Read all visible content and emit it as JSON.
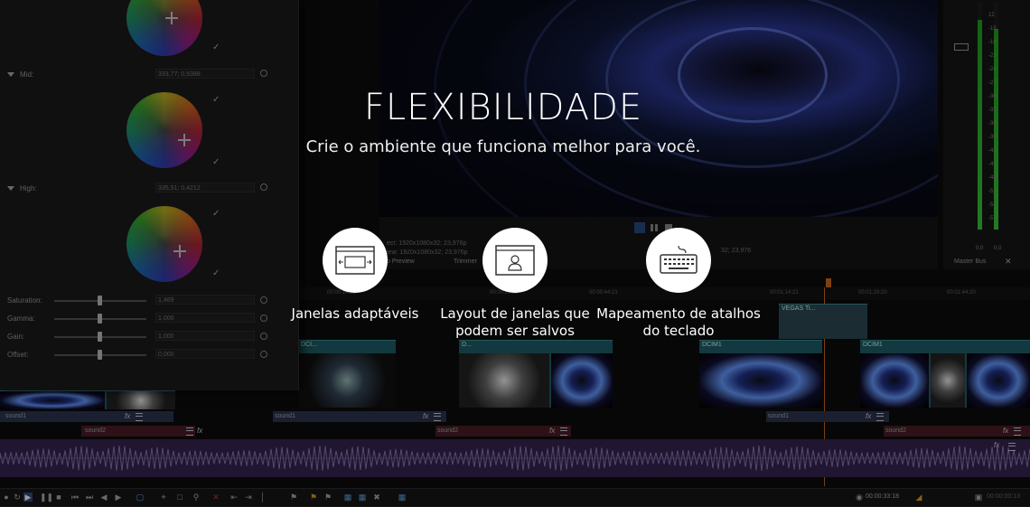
{
  "hero": {
    "title": "FLEXIBILIDADE",
    "subtitle": "Crie o ambiente que funciona melhor para você."
  },
  "features": [
    {
      "icon": "window-resize-icon",
      "label": "Janelas adaptáveis"
    },
    {
      "icon": "window-user-layout-icon",
      "label": "Layout de janelas que podem ser salvos"
    },
    {
      "icon": "keyboard-icon",
      "label": "Mapeamento de atalhos do teclado"
    }
  ],
  "color_panel": {
    "wheels": [
      {
        "label": "",
        "value": ""
      },
      {
        "label": "Mid:",
        "value": "333,77; 0,5388"
      },
      {
        "label": "High:",
        "value": "335,51; 0,4212"
      }
    ],
    "sliders": [
      {
        "label": "Saturation:",
        "value": "1,469",
        "level": 0.5
      },
      {
        "label": "Gamma:",
        "value": "1,000",
        "level": 0.5
      },
      {
        "label": "Gain:",
        "value": "1,000",
        "level": 0.5
      },
      {
        "label": "Offset:",
        "value": "0,000",
        "level": 0.5
      }
    ]
  },
  "preview": {
    "project_line": "ect:  1920x1080x32; 23,976p",
    "preview_line": "iew:  1920x1080x32; 23,976p",
    "tab_preview": "o Preview",
    "tab_trimmer": "Trimmer",
    "display_line": "32; 23,976"
  },
  "meters": {
    "ticks": [
      "12",
      "15",
      "18",
      "21",
      "24",
      "27",
      "30",
      "33",
      "36",
      "39",
      "42",
      "45",
      "48",
      "51",
      "54",
      "57"
    ],
    "left_value": "0,0",
    "right_value": "0,0",
    "bus_label": "Master Bus"
  },
  "timeline": {
    "ruler_times": [
      "00:00:14:22",
      "00:00:29:22",
      "00:00:44:21",
      "00:01:14:21",
      "00:01:29:20",
      "00:01:44:20"
    ],
    "clips": [
      "DCI...",
      "D...",
      "DCIM1",
      "DCIM1",
      "D...",
      "D..."
    ],
    "overlay_clip": "VEGAS Ti...",
    "tracks": {
      "sound1": "sound1",
      "sound2": "sound2"
    }
  },
  "status": {
    "timecode": "00:00:33:18",
    "timecode_right": "00:00:00:13"
  },
  "colors": {
    "background": "#0c0c0d",
    "clip": "#1d5d66",
    "audio_blue": "#2d3550",
    "audio_red": "#4a1c24",
    "waveform": "#35254f",
    "meter_green": "#39c739"
  }
}
